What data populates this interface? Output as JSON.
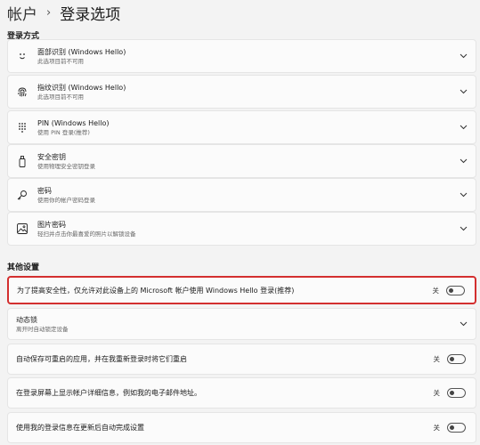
{
  "breadcrumb": {
    "parent": "帐户",
    "separator": "›",
    "current": "登录选项"
  },
  "sign_in_section": {
    "title": "登录方式",
    "items": [
      {
        "icon": "face-icon",
        "title": "面部识别 (Windows Hello)",
        "subtitle": "此选项目前不可用"
      },
      {
        "icon": "fingerprint-icon",
        "title": "指纹识别 (Windows Hello)",
        "subtitle": "此选项目前不可用"
      },
      {
        "icon": "pin-keypad-icon",
        "title": "PIN (Windows Hello)",
        "subtitle": "使用 PIN 登录(推荐)"
      },
      {
        "icon": "security-key-icon",
        "title": "安全密钥",
        "subtitle": "使用物理安全密钥登录"
      },
      {
        "icon": "key-icon",
        "title": "密码",
        "subtitle": "使用你的帐户密码登录"
      },
      {
        "icon": "picture-icon",
        "title": "图片密码",
        "subtitle": "轻扫并点击你最喜爱的照片以解锁设备"
      }
    ]
  },
  "other_section": {
    "title": "其他设置",
    "items": [
      {
        "title": "为了提高安全性，仅允许对此设备上的 Microsoft 帐户使用 Windows Hello 登录(推荐)",
        "state": "关",
        "highlighted": true
      },
      {
        "title": "动态锁",
        "subtitle": "离开时自动锁定设备"
      },
      {
        "title": "自动保存可重启的应用，并在我重新登录时将它们重启",
        "state": "关"
      },
      {
        "title": "在登录屏幕上显示帐户详细信息，例如我的电子邮件地址。",
        "state": "关"
      },
      {
        "title": "使用我的登录信息在更新后自动完成设置",
        "state": "关"
      }
    ]
  }
}
